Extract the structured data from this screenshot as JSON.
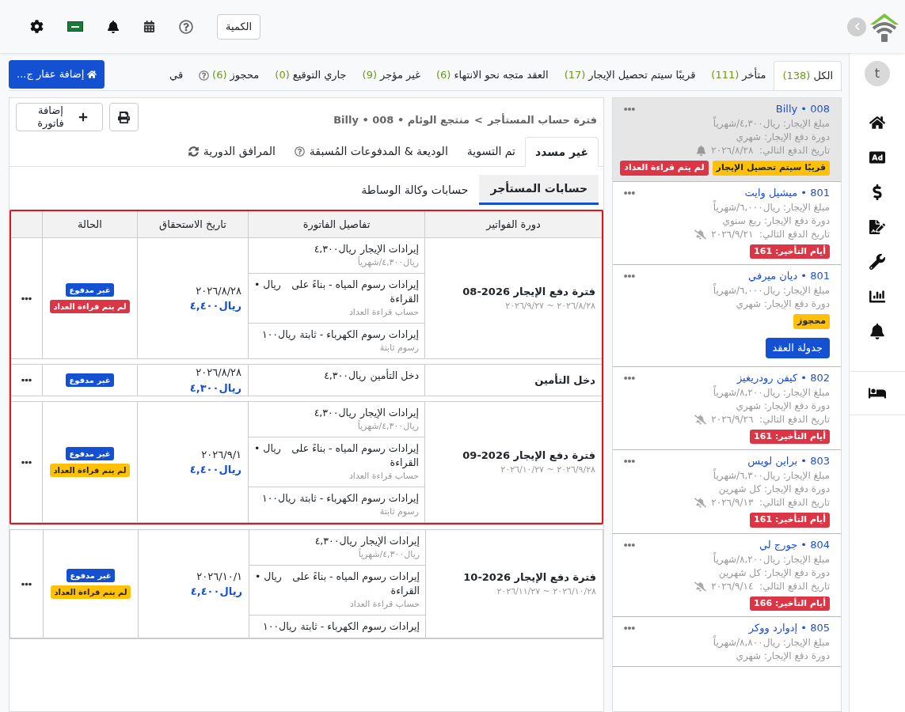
{
  "topbar": {
    "quantity_button": "الكمية"
  },
  "sidebar": {
    "avatar": "t"
  },
  "status_tabs": [
    {
      "label": "الكل",
      "count": "(138)",
      "selected": true,
      "kind": "plain"
    },
    {
      "label": "متأخر",
      "count": "(111)",
      "selected": false,
      "kind": "plain"
    },
    {
      "label": "قريبًا سيتم تحصيل الإيجار",
      "count": "(17)",
      "selected": false,
      "kind": "plain"
    },
    {
      "label": "العقد متجه نحو الانتهاء",
      "count": "(6)",
      "selected": false,
      "kind": "plain"
    },
    {
      "label": "غير مؤجر",
      "count": "(9)",
      "selected": false,
      "kind": "plain"
    },
    {
      "label": "جاري التوقيع",
      "count": "(0)",
      "selected": false,
      "kind": "plain"
    },
    {
      "label": "محجوز",
      "count": "(6)",
      "selected": false,
      "kind": "help"
    },
    {
      "label": "قي",
      "selected": false,
      "kind": "plain"
    }
  ],
  "add_property_button": "إضافة عقار ج...",
  "tenants": [
    {
      "title": "008 • Billy",
      "rent": "مبلغ الإيجار: ريال٤,٣٠٠/شهرياً",
      "cycle": "دورة دفع الإيجار: شهري",
      "next_payment": "تاريخ الدفع التالي:  ٢٠٢٦/٨/٢٨",
      "reminder": true,
      "selected": true,
      "badges": [
        {
          "label": "قريبًا سيتم تحصيل الإيجار",
          "color": "#ffc107"
        },
        {
          "label": "لم يتم قراءة العداد",
          "color": "#dc3545"
        }
      ]
    },
    {
      "title": "801 • ميشيل وايت",
      "rent": "مبلغ الإيجار: ريال٦,٠٠٠/شهرياً",
      "cycle": "دورة دفع الإيجار: ربع سنوي",
      "next_payment": "تاريخ الدفع التالي:  ٢٠٢٦/٩/٢١",
      "reminder": false,
      "selected": false,
      "badges": [
        {
          "label": "أيام التأخير: 161",
          "color": "#dc3545"
        }
      ]
    },
    {
      "title": "801 • ديان ميرفي",
      "rent": "مبلغ الإيجار: ريال٦,٠٠٠/شهرياً",
      "cycle": "دورة دفع الإيجار: شهري",
      "selected": false,
      "badges": [
        {
          "label": "محجوز",
          "color": "#ffc107"
        }
      ],
      "button": "جدولة العقد"
    },
    {
      "title": "802 • كيفن رودريغيز",
      "rent": "مبلغ الإيجار: ريال٨,٢٠٠/شهرياً",
      "cycle": "دورة دفع الإيجار: شهري",
      "next_payment": "تاريخ الدفع التالي:  ٢٠٢٦/٩/٢٦",
      "reminder": false,
      "selected": false,
      "badges": [
        {
          "label": "أيام التأخير: 161",
          "color": "#dc3545"
        }
      ]
    },
    {
      "title": "803 • براين لويس",
      "rent": "مبلغ الإيجار: ريال٦,٣٠٠/شهرياً",
      "cycle": "دورة دفع الإيجار: كل شهرين",
      "next_payment": "تاريخ الدفع التالي:  ٢٠٢٦/٩/١٣",
      "reminder": false,
      "selected": false,
      "badges": [
        {
          "label": "أيام التأخير: 161",
          "color": "#dc3545"
        }
      ]
    },
    {
      "title": "804 • جورج لي",
      "rent": "مبلغ الإيجار: ريال٨,٢٠٠/شهرياً",
      "cycle": "دورة دفع الإيجار: كل شهرين",
      "next_payment": "تاريخ الدفع التالي:  ٢٠٢٦/٩/١٤",
      "reminder": false,
      "selected": false,
      "badges": [
        {
          "label": "أيام التأخير: 166",
          "color": "#dc3545"
        }
      ]
    },
    {
      "title": "805 • إدوارد ووكر",
      "rent": "مبلغ الإيجار: ريال٨,٨٠٠/شهرياً",
      "cycle": "دورة دفع الإيجار: شهري",
      "selected": false
    }
  ],
  "panel": {
    "breadcrumb": [
      "فترة حساب المستأجر",
      "منتجع الوئام • 008 • Billy"
    ],
    "separator": ">",
    "add_invoice_button": "إضافة فاتورة",
    "tabs": [
      {
        "label": "غير مسدد",
        "selected": true,
        "kind": "plain"
      },
      {
        "label": "تم التسوية",
        "selected": false,
        "kind": "plain"
      },
      {
        "label": "الوديعة & المدفوعات المُسبقة",
        "selected": false,
        "kind": "help"
      },
      {
        "label": "المرافق الدورية",
        "selected": false,
        "kind": "sync"
      }
    ],
    "subtabs": [
      {
        "label": "حسابات المستأجر",
        "selected": true
      },
      {
        "label": "حسابات وكالة الوساطة",
        "selected": false
      }
    ],
    "table": {
      "columns": [
        "دورة الفواتير",
        "تفاصيل الفاتورة",
        "تاريخ الاستحقاق",
        "الحالة"
      ],
      "rows": [
        {
          "selected": true,
          "period": "فترة دفع الإيجار 2026-08",
          "range": "٢٠٢٦/٨/٢٨ ~ ٢٠٢٦/٩/٢٧",
          "items": [
            {
              "name": "إيرادات الإيجار",
              "amount": "ريال٤,٣٠٠",
              "note": "ريال٤,٣٠٠/شهرياً"
            },
            {
              "name": "إيرادات رسوم المياه - بناءً على القراءة",
              "amount": "ريال •",
              "note": "حساب قراءة العداد"
            },
            {
              "name": "إيرادات رسوم الكهرباء - ثابتة",
              "amount": "ريال١٠٠",
              "note": "رسوم ثابتة"
            }
          ],
          "due_date": "٢٠٢٦/٨/٢٨",
          "due_amount": "ريال٤,٤٠٠",
          "statuses": [
            {
              "label": "غير مدفوع",
              "color": "#1450d2"
            },
            {
              "label": "لم يتم قراءة العداد",
              "color": "#dc3545"
            }
          ]
        },
        {
          "selected": true,
          "period": "دخل التأمين",
          "items": [
            {
              "name": "دخل التأمين",
              "amount": "ريال٤,٣٠٠"
            }
          ],
          "due_date": "٢٠٢٦/٨/٢٨",
          "due_amount": "ريال٤,٣٠٠",
          "statuses": [
            {
              "label": "غير مدفوع",
              "color": "#1450d2"
            }
          ]
        },
        {
          "selected": true,
          "period": "فترة دفع الإيجار 2026-09",
          "range": "٢٠٢٦/٩/٢٨ ~ ٢٠٢٦/١٠/٢٧",
          "items": [
            {
              "name": "إيرادات الإيجار",
              "amount": "ريال٤,٣٠٠",
              "note": "ريال٤,٣٠٠/شهرياً"
            },
            {
              "name": "إيرادات رسوم المياه - بناءً على القراءة",
              "amount": "ريال •",
              "note": "حساب قراءة العداد"
            },
            {
              "name": "إيرادات رسوم الكهرباء - ثابتة",
              "amount": "ريال١٠٠",
              "note": "رسوم ثابتة"
            }
          ],
          "due_date": "٢٠٢٦/٩/١",
          "due_amount": "ريال٤,٤٠٠",
          "statuses": [
            {
              "label": "غير مدفوع",
              "color": "#1450d2"
            },
            {
              "label": "لم يتم قراءة العداد",
              "color": "#ffc107"
            }
          ]
        },
        {
          "selected": false,
          "period": "فترة دفع الإيجار 2026-10",
          "range": "٢٠٢٦/١٠/٢٨ ~ ٢٠٢٦/١١/٢٧",
          "items": [
            {
              "name": "إيرادات الإيجار",
              "amount": "ريال٤,٣٠٠",
              "note": "ريال٤,٣٠٠/شهرياً"
            },
            {
              "name": "إيرادات رسوم المياه - بناءً على القراءة",
              "amount": "ريال •",
              "note": "حساب قراءة العداد"
            },
            {
              "name": "إيرادات رسوم الكهرباء - ثابتة",
              "amount": "ريال١٠٠"
            }
          ],
          "due_date": "٢٠٢٦/١٠/١",
          "due_amount": "ريال٤,٤٠٠",
          "statuses": [
            {
              "label": "غير مدفوع",
              "color": "#1450d2"
            },
            {
              "label": "لم يتم قراءة العداد",
              "color": "#ffc107"
            }
          ]
        }
      ]
    }
  }
}
